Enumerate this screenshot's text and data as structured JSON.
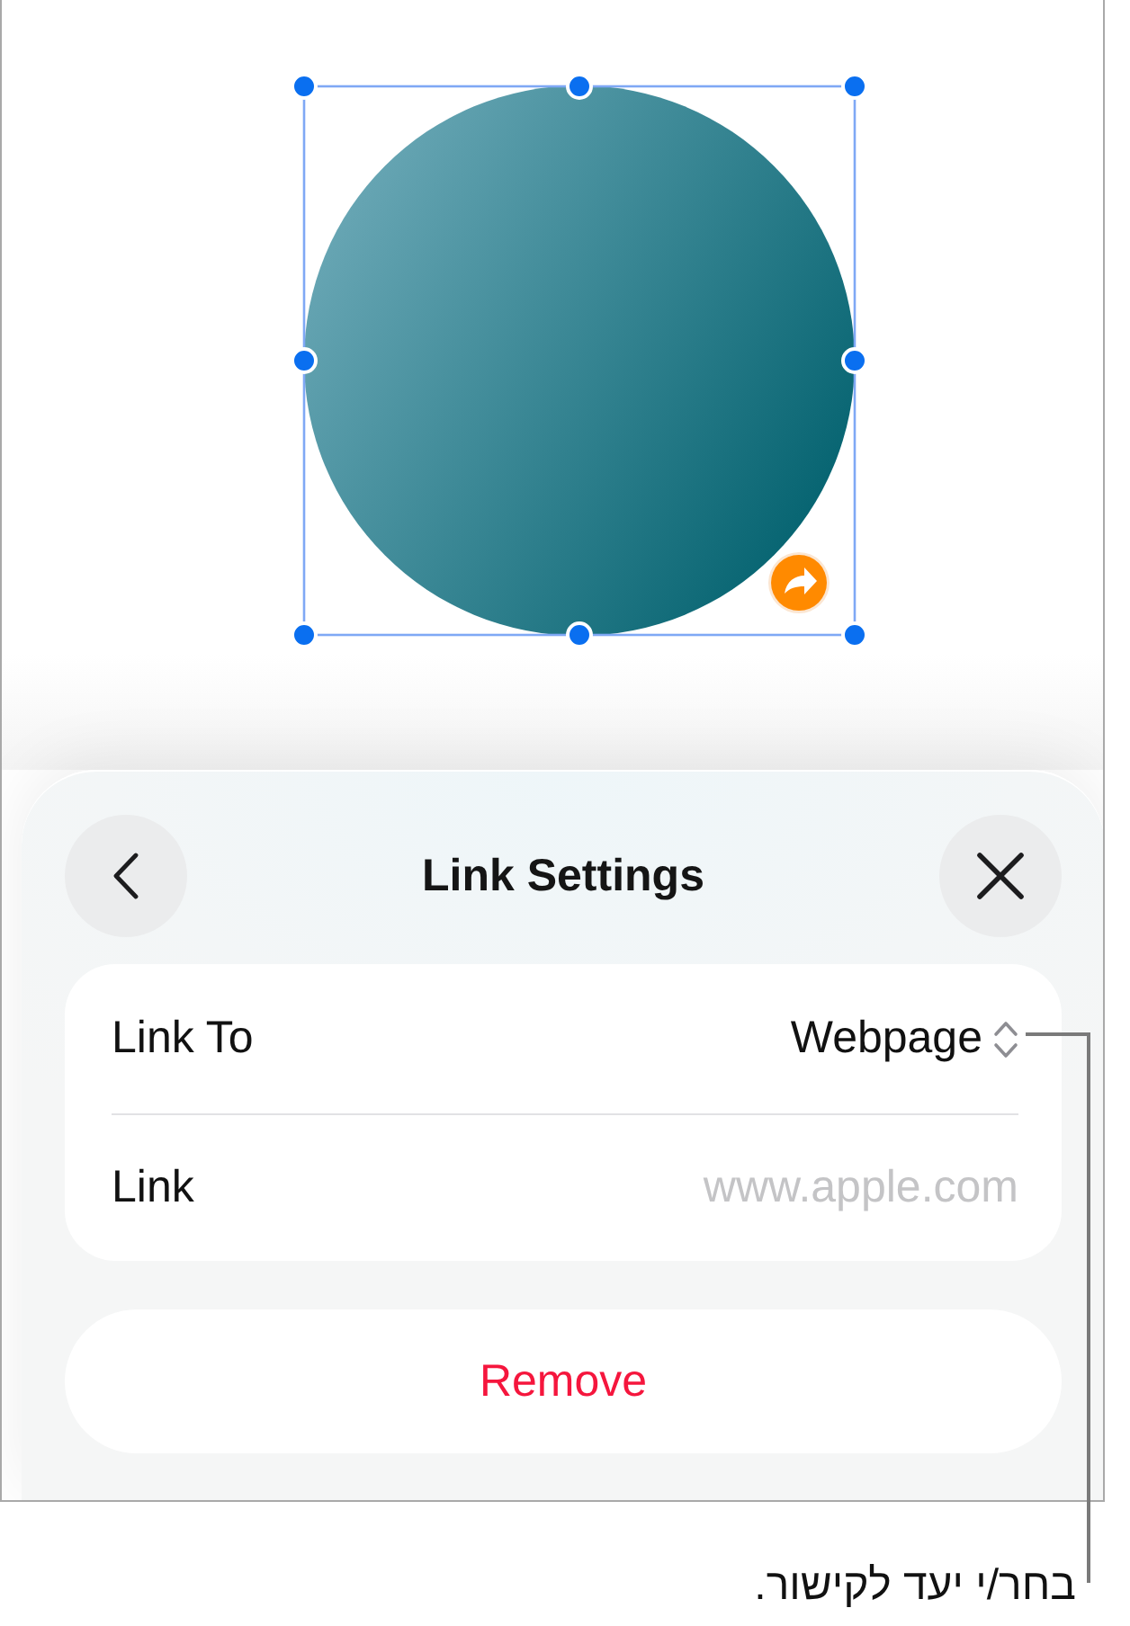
{
  "canvas": {
    "shape": {
      "selected": true
    }
  },
  "sheet": {
    "title": "Link Settings",
    "rows": [
      {
        "kind": "picker",
        "label": "Link To",
        "value": "Webpage"
      },
      {
        "kind": "field",
        "label": "Link",
        "placeholder": "www.apple.com"
      }
    ],
    "remove_button": "Remove"
  },
  "callout": "בחר/י יעד לקישור."
}
